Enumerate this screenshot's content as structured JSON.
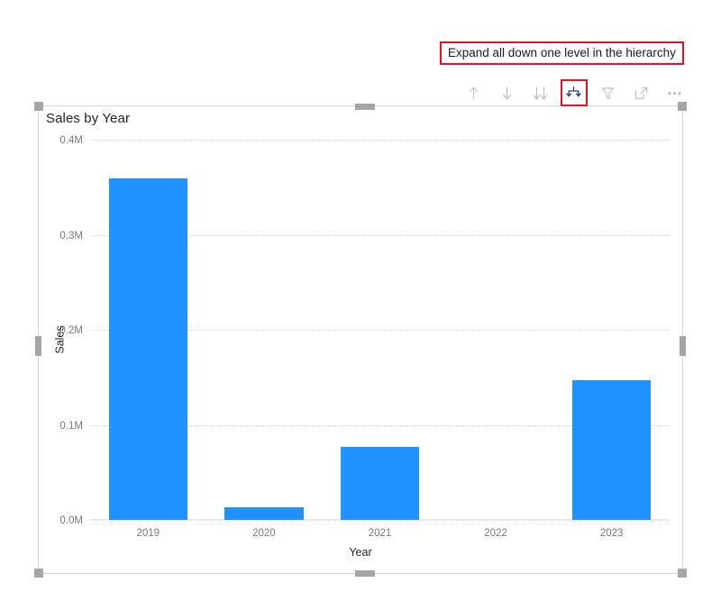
{
  "tooltip": {
    "text": "Expand all down one level in the hierarchy",
    "border_color": "#e81123"
  },
  "toolbar": {
    "buttons": [
      {
        "name": "drill-up-icon",
        "label": "Drill up",
        "state": "enabled"
      },
      {
        "name": "drill-down-icon",
        "label": "Drill down",
        "state": "enabled"
      },
      {
        "name": "go-to-next-level-icon",
        "label": "Go to the next level in the hierarchy",
        "state": "enabled"
      },
      {
        "name": "expand-all-down-icon",
        "label": "Expand all down one level in the hierarchy",
        "state": "highlighted"
      },
      {
        "name": "filter-icon",
        "label": "Filters",
        "state": "enabled"
      },
      {
        "name": "focus-mode-icon",
        "label": "Focus mode",
        "state": "enabled"
      },
      {
        "name": "more-options-icon",
        "label": "More options",
        "state": "enabled"
      }
    ]
  },
  "visual": {
    "title": "Sales by Year",
    "selected": true
  },
  "chart_data": {
    "type": "bar",
    "title": "Sales by Year",
    "xlabel": "Year",
    "ylabel": "Sales",
    "categories": [
      "2019",
      "2020",
      "2021",
      "2022",
      "2023"
    ],
    "values": [
      359000,
      13000,
      77000,
      0,
      147000
    ],
    "ylim": [
      0,
      400000
    ],
    "yticks": [
      0,
      100000,
      200000,
      300000,
      400000
    ],
    "ytick_labels": [
      "0.0M",
      "0.1M",
      "0.2M",
      "0.3M",
      "0.4M"
    ],
    "grid": true,
    "legend": "none",
    "bar_color": "#1f92ff"
  }
}
